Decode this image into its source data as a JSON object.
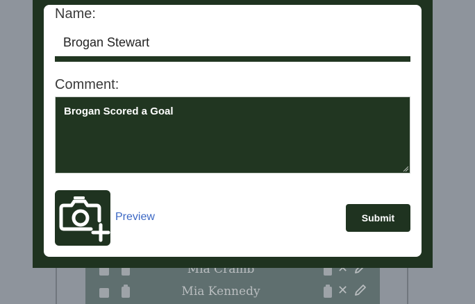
{
  "background_list": {
    "rows": [
      {
        "name": "Mia Cramb"
      },
      {
        "name": "Mia Kennedy"
      }
    ],
    "icons": {
      "checkbox": "checkbox-icon",
      "clipboard": "clipboard-icon",
      "delete": "close-icon",
      "edit": "pencil-icon"
    }
  },
  "form": {
    "name_label": "Name:",
    "name_value": "Brogan Stewart",
    "comment_label": "Comment:",
    "comment_value": "Brogan Scored a Goal",
    "camera_icon": "camera-add-icon",
    "preview_label": "Preview",
    "submit_label": "Submit"
  },
  "colors": {
    "brand_green": "#1f3320",
    "link_blue": "#3b67c4",
    "overlay_gray": "#8e949c"
  }
}
